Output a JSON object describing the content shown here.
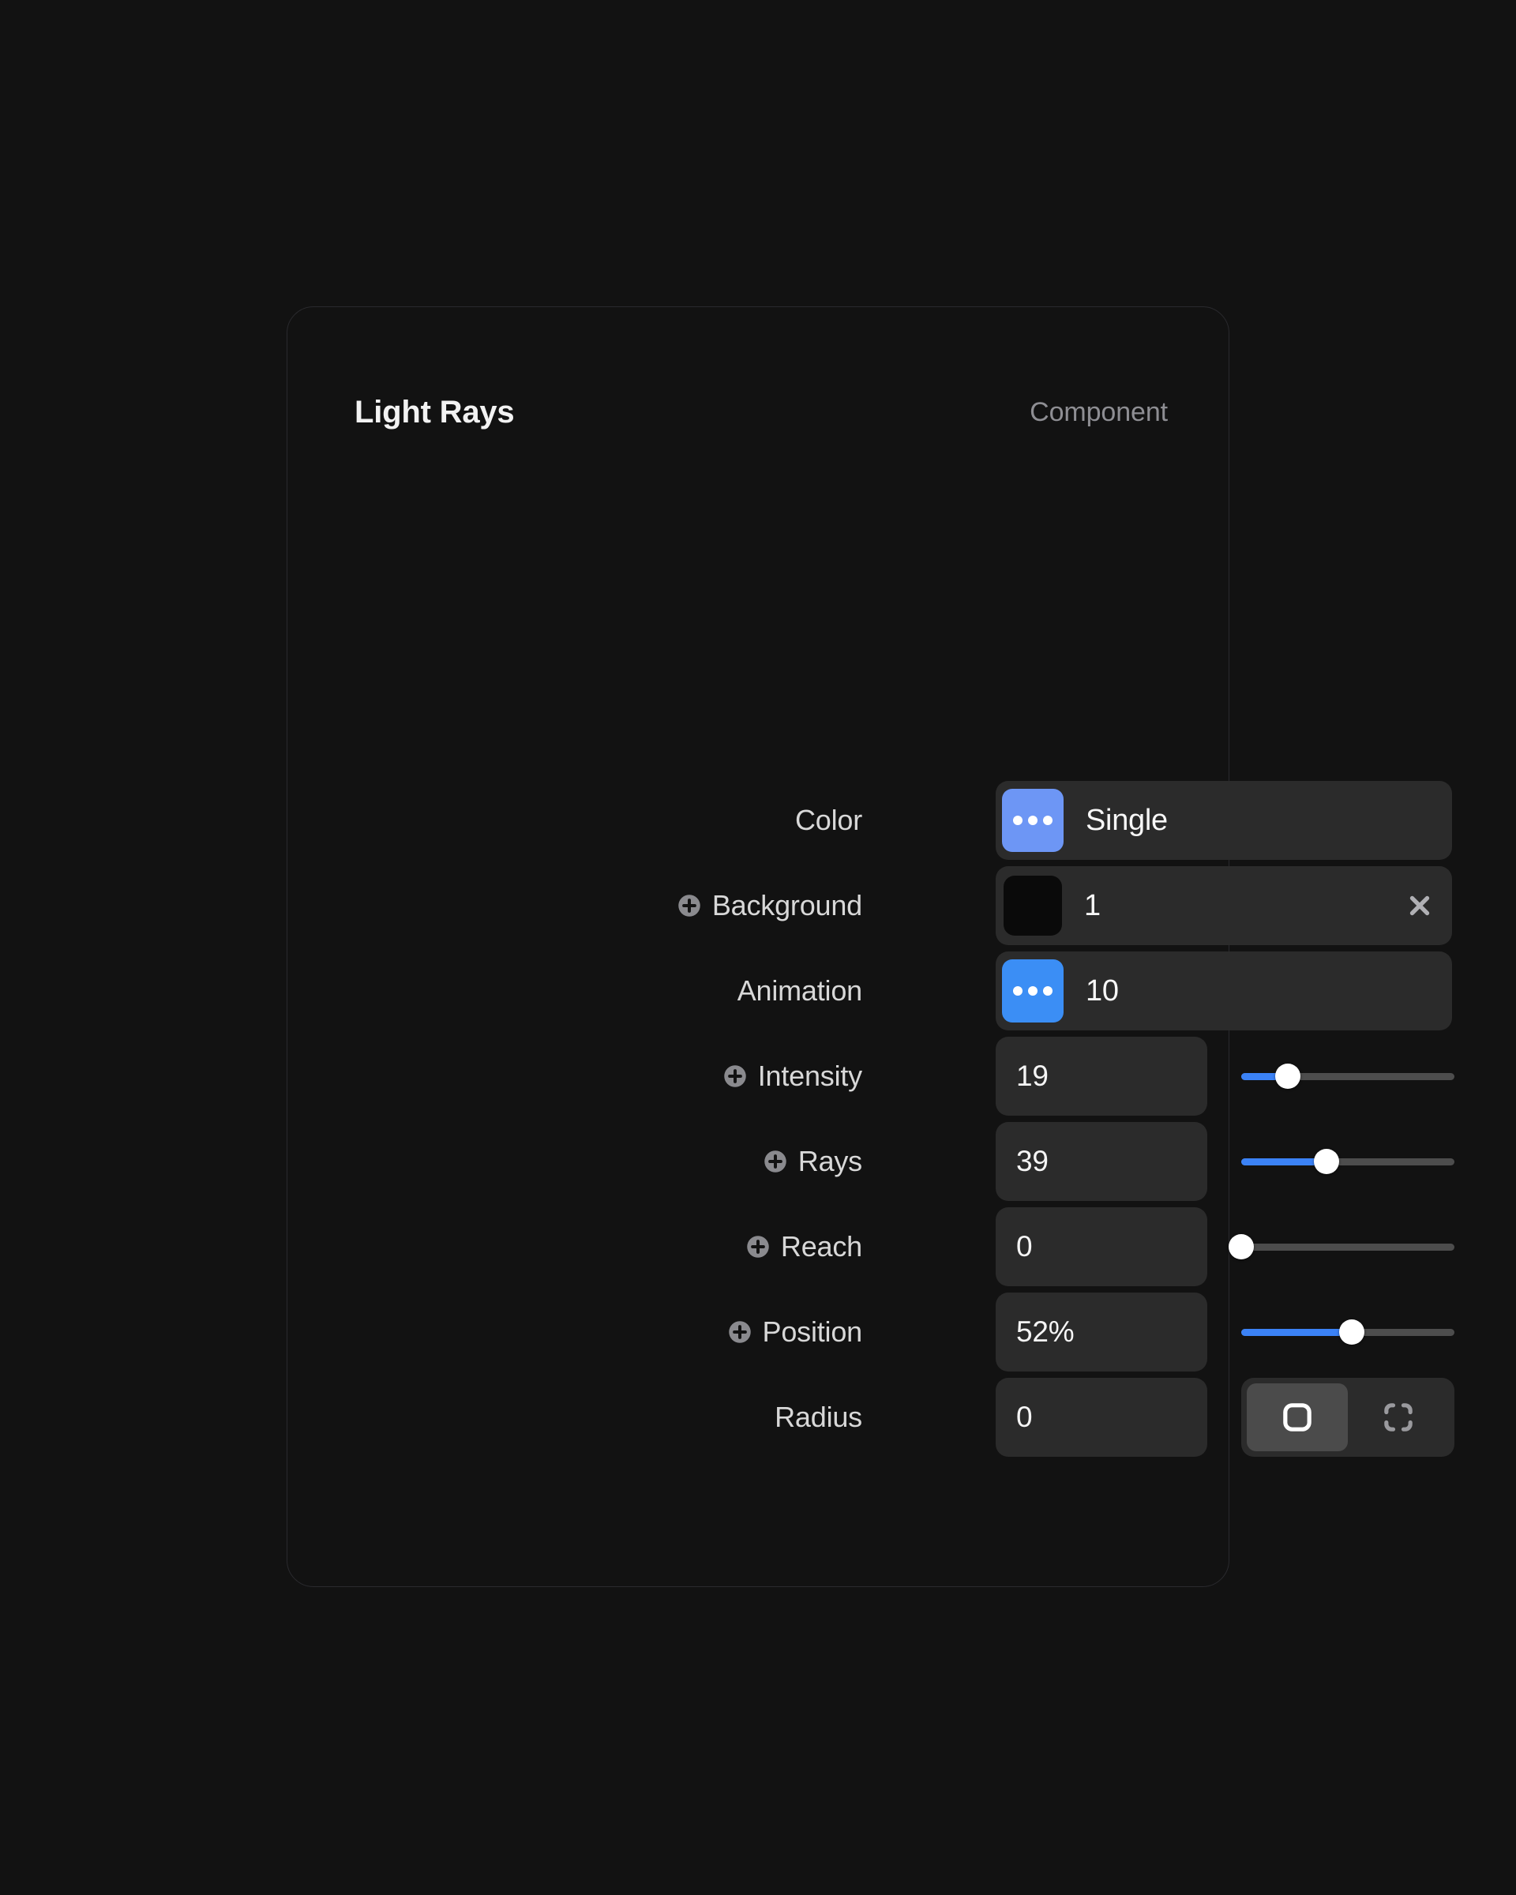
{
  "panel": {
    "title": "Light Rays",
    "kind_label": "Component",
    "accent_blue": "#3b82f6",
    "badge_blue_light": "#6d96f5",
    "badge_blue_bright": "#3b8ef5",
    "panel_bg": "#121212",
    "field_bg": "#2b2b2b",
    "segment_active_bg": "#4b4b4b"
  },
  "rows": {
    "color": {
      "label": "Color",
      "value": "Single",
      "badge_icon": "dots-icon",
      "badge_color": "#6d96f5",
      "has_add_icon": false
    },
    "background": {
      "label": "Background",
      "value": "1",
      "swatch_color": "#0a0a0a",
      "remove_icon": "close-icon",
      "has_add_icon": true
    },
    "animation": {
      "label": "Animation",
      "value": "10",
      "badge_icon": "dots-icon",
      "badge_color": "#3b8ef5",
      "has_add_icon": false
    },
    "intensity": {
      "label": "Intensity",
      "value": "19",
      "slider_percent": 22,
      "has_add_icon": true
    },
    "rays": {
      "label": "Rays",
      "value": "39",
      "slider_percent": 40,
      "has_add_icon": true
    },
    "reach": {
      "label": "Reach",
      "value": "0",
      "slider_percent": 0,
      "has_add_icon": true
    },
    "position": {
      "label": "Position",
      "value": "52%",
      "slider_percent": 52,
      "has_add_icon": true
    },
    "radius": {
      "label": "Radius",
      "value": "0",
      "has_add_icon": false,
      "segments": [
        {
          "icon": "rounded-square-icon",
          "selected": true
        },
        {
          "icon": "independent-corners-icon",
          "selected": false
        }
      ]
    }
  }
}
